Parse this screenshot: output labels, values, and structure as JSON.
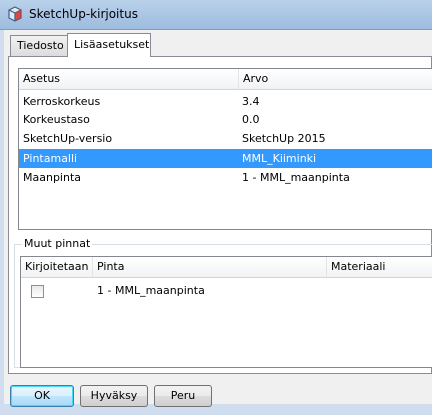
{
  "window": {
    "title": "SketchUp-kirjoitus"
  },
  "tabs": [
    {
      "label": "Tiedosto",
      "active": false
    },
    {
      "label": "Lisäasetukset",
      "active": true
    }
  ],
  "settings_table": {
    "columns": [
      "Asetus",
      "Arvo"
    ],
    "rows": [
      {
        "setting": "Kerroskorkeus",
        "value": "3.4",
        "selected": false
      },
      {
        "setting": "Korkeustaso",
        "value": "0.0",
        "selected": false
      },
      {
        "setting": "SketchUp-versio",
        "value": "SketchUp 2015",
        "selected": false
      },
      {
        "setting": "Pintamalli",
        "value": "MML_Kiiminki",
        "selected": true
      },
      {
        "setting": "Maanpinta",
        "value": "1 - MML_maanpinta",
        "selected": false
      }
    ]
  },
  "other_surfaces": {
    "group_label": "Muut pinnat",
    "columns": [
      "Kirjoitetaan",
      "Pinta",
      "Materiaali"
    ],
    "rows": [
      {
        "write": false,
        "surface": "1 - MML_maanpinta",
        "material": ""
      }
    ]
  },
  "buttons": {
    "ok": "OK",
    "accept": "Hyväksy",
    "cancel": "Peru"
  },
  "colors": {
    "selection": "#3399ff",
    "titlebar": "#b9d1ea"
  }
}
